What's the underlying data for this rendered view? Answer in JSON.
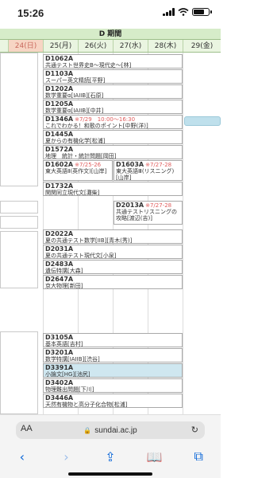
{
  "status": {
    "time": "15:26"
  },
  "schedule": {
    "period": "D 期間",
    "days": [
      {
        "label": "",
        "highlight": false
      },
      {
        "label": "24(日)",
        "highlight": true
      },
      {
        "label": "25(月)",
        "highlight": false
      },
      {
        "label": "26(火)",
        "highlight": false
      },
      {
        "label": "27(水)",
        "highlight": false
      },
      {
        "label": "28(木)",
        "highlight": false
      },
      {
        "label": "29(金)",
        "highlight": false
      }
    ],
    "cells": [
      {
        "code": "D1062A",
        "name": "共通テスト世界史B～現代史～[林]",
        "date": ""
      },
      {
        "code": "D1103A",
        "name": "スーパー英文精読[平野]",
        "date": ""
      },
      {
        "code": "D1202A",
        "name": "数学重要α[IAIIB][石原]",
        "date": ""
      },
      {
        "code": "D1205A",
        "name": "数学重要α[IAIIB][中井]",
        "date": ""
      },
      {
        "code": "D1346A",
        "name": "これでわかる！和歌のポイント[中野(洋)]",
        "date": "※7/29　10:00～16:30"
      },
      {
        "code": "D1445A",
        "name": "夏からの有機化学[松浦]",
        "date": ""
      },
      {
        "code": "D1572A",
        "name": "地理　統計・統計問題[岡田]",
        "date": ""
      },
      {
        "code": "D1602A",
        "name": "東大英語Ⅱ(英作文)[山岸]",
        "date": "※7/25-26"
      },
      {
        "code": "D1603A",
        "name": "東大英語Ⅲ(リスニング)[山岸]",
        "date": "※7/27-28"
      },
      {
        "code": "D1732A",
        "name": "関関同立現代文[灘柴]",
        "date": ""
      },
      {
        "code": "D2013A",
        "name": "共通テストリスニングの攻略[渡辺(吉)]",
        "date": "※7/27-28"
      },
      {
        "code": "D2022A",
        "name": "夏の共通テスト数学[IIB][青木(秀)]",
        "date": ""
      },
      {
        "code": "D2031A",
        "name": "夏の共通テスト現代文[小泉]",
        "date": ""
      },
      {
        "code": "D2483A",
        "name": "遺伝特講[大森]",
        "date": ""
      },
      {
        "code": "D2647A",
        "name": "京大物理[新田]",
        "date": ""
      },
      {
        "code": "D3105A",
        "name": "基本英語[吉村]",
        "date": ""
      },
      {
        "code": "D3201A",
        "name": "数学特講[IAIIB][渋谷]",
        "date": ""
      },
      {
        "code": "D3391A",
        "name": "小論文[HG][池尻]",
        "date": ""
      },
      {
        "code": "D3402A",
        "name": "物理難出問題[下川]",
        "date": ""
      },
      {
        "code": "D3446A",
        "name": "天然有機物と高分子化合物[松浦]",
        "date": ""
      }
    ]
  },
  "browser": {
    "text_size_label": "AA",
    "url": "sundai.ac.jp",
    "reload_icon": "↻",
    "lock_icon": "🔒",
    "toolbar": [
      "‹",
      "›",
      "⇪",
      "📖",
      "⧉"
    ]
  }
}
